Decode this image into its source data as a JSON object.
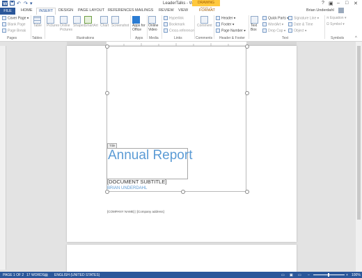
{
  "window": {
    "title": "LeaderTalks - Word",
    "user": "Brian Underdahl",
    "help_icon": "?",
    "contextual_tab_group": "DRAWING TOOLS"
  },
  "tabs": [
    "FILE",
    "HOME",
    "INSERT",
    "DESIGN",
    "PAGE LAYOUT",
    "REFERENCES",
    "MAILINGS",
    "REVIEW",
    "VIEW",
    "FORMAT"
  ],
  "ribbon": {
    "pages": {
      "cover_page": "Cover Page",
      "blank_page": "Blank Page",
      "page_break": "Page Break",
      "label": "Pages"
    },
    "tables": {
      "table": "Table",
      "label": "Tables"
    },
    "illustrations": {
      "pictures": "Pictures",
      "online_pictures": "Online Pictures",
      "shapes": "Shapes",
      "smartart": "SmartArt",
      "chart": "Chart",
      "screenshot": "Screenshot",
      "label": "Illustrations"
    },
    "apps": {
      "apps_for_office": "Apps for Office",
      "label": "Apps"
    },
    "media": {
      "online_video": "Online Video",
      "label": "Media"
    },
    "links": {
      "hyperlink": "Hyperlink",
      "bookmark": "Bookmark",
      "cross_reference": "Cross-reference",
      "label": "Links"
    },
    "comments": {
      "comment": "Comment",
      "label": "Comments"
    },
    "header_footer": {
      "header": "Header",
      "footer": "Footer",
      "page_number": "Page Number",
      "label": "Header & Footer"
    },
    "text": {
      "text_box": "Text Box",
      "quick_parts": "Quick Parts",
      "wordart": "WordArt",
      "drop_cap": "Drop Cap",
      "signature_line": "Signature Line",
      "date_time": "Date & Time",
      "object": "Object",
      "label": "Text"
    },
    "symbols": {
      "equation": "Equation",
      "symbol": "Symbol",
      "label": "Symbols"
    }
  },
  "document": {
    "title_tag": "Title",
    "title": "Annual Report",
    "subtitle": "[DOCUMENT SUBTITLE]",
    "author": "BRIAN UNDERDAHL",
    "company_line": "[COMPANY NAME]  |  [Company address]"
  },
  "status": {
    "page": "PAGE 1 OF 2",
    "words": "17 WORDS",
    "language": "ENGLISH (UNITED STATES)",
    "zoom": "100%"
  },
  "colors": {
    "accent": "#2b579a",
    "title_blue": "#5b9bd5",
    "drawing_tools": "#ffc83d"
  }
}
